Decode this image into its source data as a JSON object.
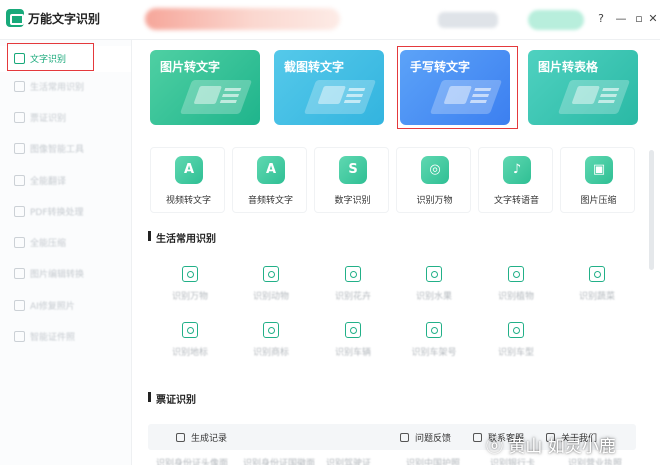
{
  "app": {
    "title": "万能文字识别"
  },
  "sidebar": {
    "items": [
      {
        "label": "文字识别",
        "active": true
      },
      {
        "label": "生活常用识别"
      },
      {
        "label": "票证识别"
      },
      {
        "label": "图像智能工具"
      },
      {
        "label": "全能翻译"
      },
      {
        "label": "PDF转换处理"
      },
      {
        "label": "全能压缩"
      },
      {
        "label": "图片编辑转换"
      },
      {
        "label": "AI修复照片"
      },
      {
        "label": "智能证件照"
      }
    ]
  },
  "hero_cards": [
    {
      "title": "图片转文字",
      "color": "#2fbf94"
    },
    {
      "title": "截图转文字",
      "color": "#3bb9e3"
    },
    {
      "title": "手写转文字",
      "color": "#4a8ef4"
    },
    {
      "title": "图片转表格",
      "color": "#33c1ad"
    }
  ],
  "tools": [
    {
      "label": "视频转文字",
      "glyph": "A"
    },
    {
      "label": "音频转文字",
      "glyph": "A"
    },
    {
      "label": "数字识别",
      "glyph": "S"
    },
    {
      "label": "识别万物",
      "glyph": "◎"
    },
    {
      "label": "文字转语音",
      "glyph": "♪"
    },
    {
      "label": "图片压缩",
      "glyph": "▣"
    }
  ],
  "sections": {
    "life": "生活常用识别",
    "tickets": "票证识别"
  },
  "life_items": [
    "识别万物",
    "识别动物",
    "识别花卉",
    "识别水果",
    "识别植物",
    "识别蔬菜",
    "识别地标",
    "识别商标",
    "识别车辆",
    "识别车架号",
    "识别车型"
  ],
  "bottom_bar": {
    "generate": "生成记录",
    "feedback": "问题反馈",
    "contact": "联系客服",
    "about": "关于我们"
  },
  "ticket_items_cutoff": [
    "识别身份证头像面",
    "识别身份证国徽面",
    "识别驾驶证",
    "识别中国护照",
    "识别银行卡",
    "识别营业执照"
  ],
  "watermark": "ⓞ 黄山 如灵小鹿",
  "colors": {
    "accent": "#18a97a",
    "highlight": "#e4393c"
  }
}
